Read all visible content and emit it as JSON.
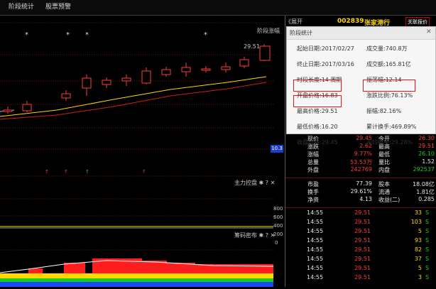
{
  "tabs": [
    {
      "label": "阶段统计"
    },
    {
      "label": "股票预警"
    }
  ],
  "chart": {
    "legend_label": "阶段涨幅",
    "price_marker": "29.51",
    "hline_label": "10.3",
    "indicator1": "主力控盘",
    "indicator2": "筹码密布",
    "axis_ticks": [
      "800",
      "600",
      "400",
      "200",
      "0"
    ],
    "controls": [
      "✱",
      "?",
      "✕"
    ]
  },
  "stock": {
    "code": "002839",
    "name": "张家港行",
    "collapse_label": "《展开",
    "toggle_label": "关联报价"
  },
  "popup": {
    "title": "阶段统计",
    "close_label": "✕",
    "rows": [
      [
        {
          "label": "起始日期",
          "value": "2017/02/27"
        },
        {
          "label": "成交量",
          "value": "740.8万"
        }
      ],
      [
        {
          "label": "终止日期",
          "value": "2017/03/16"
        },
        {
          "label": "成交额",
          "value": "165.81亿"
        }
      ],
      [
        {
          "label": "时段长度",
          "value": "14 周期"
        },
        {
          "label": "振荡幅",
          "value": "12.14"
        }
      ],
      [
        {
          "label": "开盘价格",
          "value": "16.83"
        },
        {
          "label": "涨跌比例",
          "value": "76.13%"
        }
      ],
      [
        {
          "label": "最高价格",
          "value": "29.51"
        },
        {
          "label": "振幅",
          "value": "82.16%"
        }
      ],
      [
        {
          "label": "最低价格",
          "value": "16.20"
        },
        {
          "label": "累计换手",
          "value": "469.89%"
        }
      ],
      [
        {
          "label": "收盘价格",
          "value": "29.45"
        },
        {
          "label": "平均换手",
          "value": "29.28%"
        }
      ]
    ]
  },
  "quote": {
    "rows": [
      {
        "l1": "现价",
        "v1": "29.45",
        "l2": "今开",
        "v2": "26.30"
      },
      {
        "l1": "涨跌",
        "v1": "2.62",
        "l2": "最高",
        "v2": "29.51"
      },
      {
        "l1": "涨幅",
        "v1": "9.77%",
        "l2": "最低",
        "v2": "26.10"
      },
      {
        "l1": "总量",
        "v1": "53.53万",
        "l2": "量比",
        "v2": "1.52"
      },
      {
        "l1": "外盘",
        "v1": "242769",
        "l2": "内盘",
        "v2": "292537"
      }
    ],
    "rows2": [
      {
        "l1": "市盈",
        "v1": "77.39",
        "l2": "股本",
        "v2": "18.08亿"
      },
      {
        "l1": "换手",
        "v1": "29.61%",
        "l2": "流通",
        "v2": "1.81亿"
      },
      {
        "l1": "净资",
        "v1": "4.13",
        "l2": "收益(二)",
        "v2": "0.285"
      }
    ]
  },
  "ticks": [
    {
      "time": "14:55",
      "price": "29.51",
      "vol": "33",
      "dir": "S"
    },
    {
      "time": "14:55",
      "price": "29.51",
      "vol": "103",
      "dir": "S"
    },
    {
      "time": "14:55",
      "price": "29.51",
      "vol": "5",
      "dir": "S"
    },
    {
      "time": "14:55",
      "price": "29.51",
      "vol": "93",
      "dir": "S"
    },
    {
      "time": "14:55",
      "price": "29.51",
      "vol": "82",
      "dir": "S"
    },
    {
      "time": "14:55",
      "price": "29.51",
      "vol": "37",
      "dir": "S"
    },
    {
      "time": "14:55",
      "price": "29.51",
      "vol": "5",
      "dir": "S"
    },
    {
      "time": "14:55",
      "price": "29.51",
      "vol": "3",
      "dir": "S"
    }
  ]
}
